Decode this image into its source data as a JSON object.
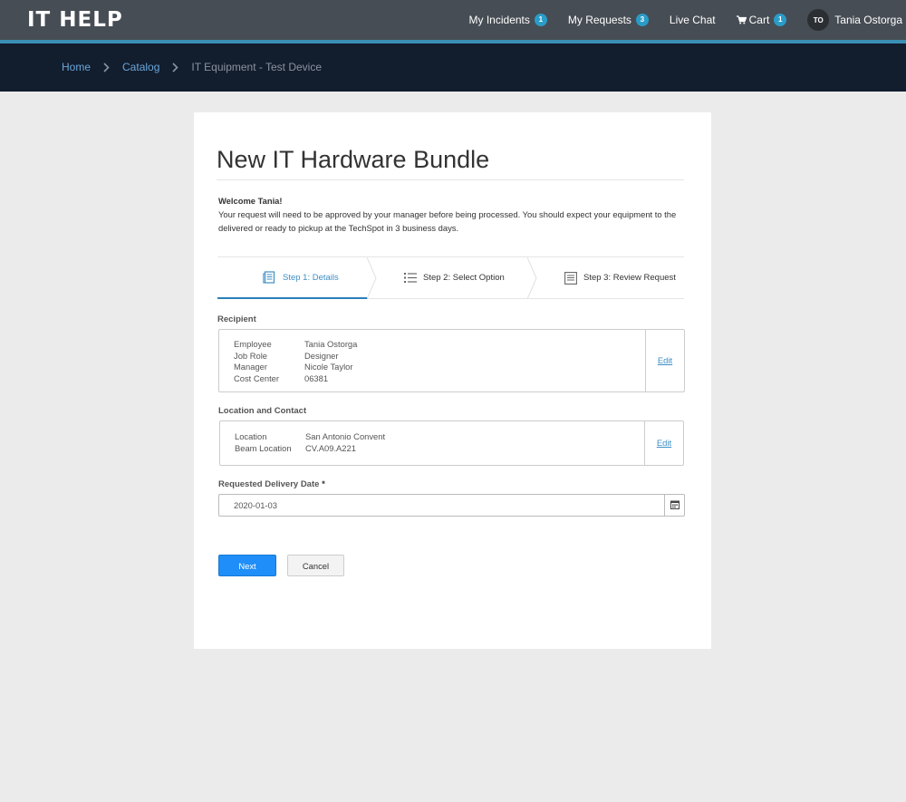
{
  "header": {
    "logo": "IT HELP",
    "nav": {
      "incidents_label": "My Incidents",
      "incidents_count": "1",
      "requests_label": "My Requests",
      "requests_count": "3",
      "live_chat_label": "Live Chat",
      "cart_label": "Cart",
      "cart_count": "1",
      "user_initials": "TO",
      "user_name": "Tania Ostorga"
    }
  },
  "breadcrumb": {
    "home": "Home",
    "catalog": "Catalog",
    "current": "IT Equipment - Test Device"
  },
  "page": {
    "title": "New IT Hardware Bundle",
    "welcome": "Welcome Tania!",
    "intro": "Your request will need to be approved by your manager before being processed. You should expect your equipment to the delivered or ready to pickup at the TechSpot in 3 business days."
  },
  "steps": [
    {
      "label": "Step 1: Details",
      "icon": "document-icon",
      "active": true
    },
    {
      "label": "Step 2: Select Option",
      "icon": "list-icon",
      "active": false
    },
    {
      "label": "Step 3: Review Request",
      "icon": "review-icon",
      "active": false
    }
  ],
  "recipient": {
    "label": "Recipient",
    "rows": [
      {
        "key": "Employee",
        "value": "Tania Ostorga"
      },
      {
        "key": "Job Role",
        "value": "Designer"
      },
      {
        "key": "Manager",
        "value": "Nicole Taylor"
      },
      {
        "key": "Cost Center",
        "value": "06381"
      }
    ],
    "edit_label": "Edit"
  },
  "location": {
    "label": "Location and Contact",
    "rows": [
      {
        "key": "Location",
        "value": "San Antonio Convent"
      },
      {
        "key": "Beam Location",
        "value": "CV.A09.A221"
      }
    ],
    "edit_label": "Edit"
  },
  "delivery": {
    "label": "Requested Delivery Date",
    "required_mark": "*",
    "value": "2020-01-03"
  },
  "actions": {
    "next_label": "Next",
    "cancel_label": "Cancel"
  },
  "colors": {
    "header_bg": "#474d54",
    "accent": "#3a8fb5",
    "breadcrumb_bg": "#121d2e",
    "primary_button": "#1f8ef8",
    "badge": "#2a9cc8"
  }
}
